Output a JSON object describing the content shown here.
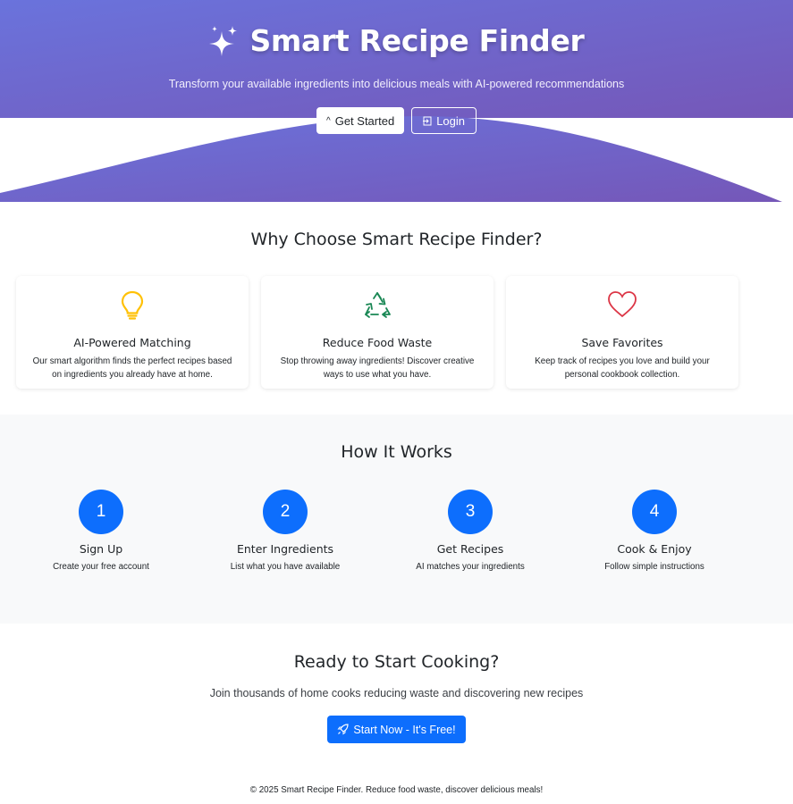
{
  "colors": {
    "hero_gradient_start": "#6a73dc",
    "hero_gradient_end": "#7557b8",
    "primary": "#0d6efd",
    "light_section": "#f8f9fa",
    "bulb": "#ffc107",
    "recycle": "#198754",
    "heart": "#dc3545"
  },
  "hero": {
    "icon": "stars-icon",
    "title": "Smart Recipe Finder",
    "subtitle": "Transform your available ingredients into delicious meals with AI-powered recommendations",
    "get_started_icon": "rocket-icon",
    "get_started_label": "Get Started",
    "login_icon": "login-icon",
    "login_label": "Login"
  },
  "features": {
    "title": "Why Choose Smart Recipe Finder?",
    "items": [
      {
        "icon": "lightbulb-icon",
        "title": "AI-Powered Matching",
        "desc": "Our smart algorithm finds the perfect recipes based on ingredients you already have at home."
      },
      {
        "icon": "recycle-icon",
        "title": "Reduce Food Waste",
        "desc": "Stop throwing away ingredients! Discover creative ways to use what you have."
      },
      {
        "icon": "heart-icon",
        "title": "Save Favorites",
        "desc": "Keep track of recipes you love and build your personal cookbook collection."
      }
    ]
  },
  "how": {
    "title": "How It Works",
    "steps": [
      {
        "num": "1",
        "title": "Sign Up",
        "desc": "Create your free account"
      },
      {
        "num": "2",
        "title": "Enter Ingredients",
        "desc": "List what you have available"
      },
      {
        "num": "3",
        "title": "Get Recipes",
        "desc": "AI matches your ingredients"
      },
      {
        "num": "4",
        "title": "Cook & Enjoy",
        "desc": "Follow simple instructions"
      }
    ]
  },
  "cta": {
    "title": "Ready to Start Cooking?",
    "subtitle": "Join thousands of home cooks reducing waste and discovering new recipes",
    "button_icon": "rocket-icon",
    "button_label": "Start Now - It's Free!"
  },
  "footer": {
    "text": "© 2025 Smart Recipe Finder. Reduce food waste, discover delicious meals!"
  }
}
